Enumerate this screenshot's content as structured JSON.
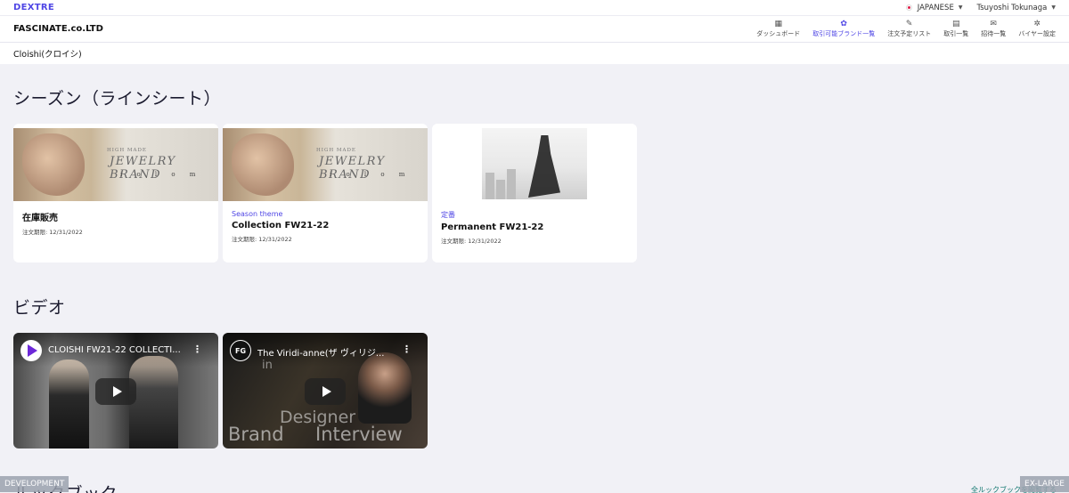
{
  "topbar": {
    "logo": "DEXTRE",
    "language": "JAPANESE",
    "user": "Tsuyoshi Tokunaga"
  },
  "navbar": {
    "company": "FASCINATE.co.LTD",
    "items": [
      {
        "label": "ダッシュボード",
        "icon": "dashboard-icon",
        "glyph": "▦"
      },
      {
        "label": "取引可能ブランド一覧",
        "icon": "brand-icon",
        "glyph": "✿"
      },
      {
        "label": "注文予定リスト",
        "icon": "list-icon",
        "glyph": "✎"
      },
      {
        "label": "取引一覧",
        "icon": "calculator-icon",
        "glyph": "▤"
      },
      {
        "label": "招待一覧",
        "icon": "mail-icon",
        "glyph": "✉"
      },
      {
        "label": "バイヤー設定",
        "icon": "gear-icon",
        "glyph": "✲"
      }
    ]
  },
  "brand": "Cloishi(クロイシ)",
  "sections": {
    "season": "シーズン（ラインシート）",
    "video": "ビデオ",
    "lookbook": "ルックブック"
  },
  "season_cards": [
    {
      "tag": "",
      "name": "在庫販売",
      "date": "注文期限: 12/31/2022",
      "image_text": [
        "HIGH MADE",
        "JEWELRY BRAND",
        "i o l o m"
      ]
    },
    {
      "tag": "Season theme",
      "name": "Collection FW21-22",
      "date": "注文期限: 12/31/2022",
      "image_text": [
        "HIGH MADE",
        "JEWELRY BRAND",
        "i o l o m"
      ]
    },
    {
      "tag": "定番",
      "name": "Permanent FW21-22",
      "date": "注文期限: 12/31/2022"
    }
  ],
  "videos": [
    {
      "title": "CLOISHI FW21-22 COLLECTI...",
      "channel_icon": "play-logo-icon"
    },
    {
      "title": "The Viridi-anne(ザ ヴィリジ...",
      "channel_icon": "fg-logo-icon",
      "channel_text": "FG",
      "overlay_lines": [
        "in",
        "Designer",
        "Brand",
        "Interview"
      ]
    }
  ],
  "lookbook_link": "全ルックブックを閲覧する",
  "badges": {
    "left": "DEVELOPMENT",
    "right": "EX-LARGE"
  }
}
